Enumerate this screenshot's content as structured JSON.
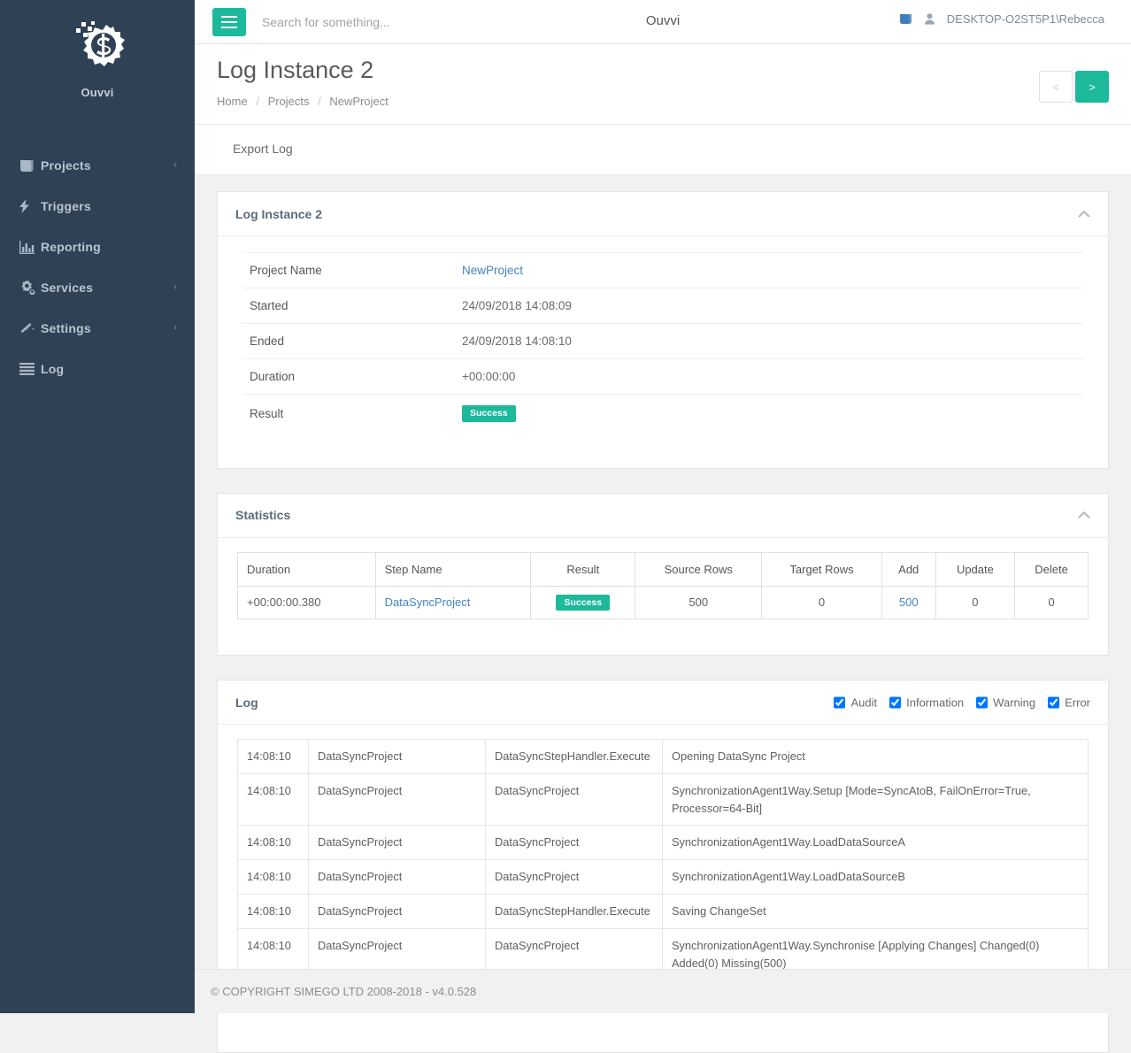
{
  "brand": {
    "name": "Ouvvi",
    "logo_icon": "gear-s-logo-icon"
  },
  "sidebar": {
    "items": [
      {
        "label": "Projects",
        "icon": "book-icon",
        "caret": "‹"
      },
      {
        "label": "Triggers",
        "icon": "bolt-icon",
        "caret": ""
      },
      {
        "label": "Reporting",
        "icon": "bar-chart-icon",
        "caret": ""
      },
      {
        "label": "Services",
        "icon": "cogs-icon",
        "caret": "‹"
      },
      {
        "label": "Settings",
        "icon": "magic-wand-icon",
        "caret": "‹"
      },
      {
        "label": "Log",
        "icon": "list-icon",
        "caret": ""
      }
    ]
  },
  "topbar": {
    "menu_icon": "hamburger-icon",
    "search_placeholder": "Search for something...",
    "search_value": "",
    "title": "Ouvvi",
    "book_icon": "book-icon",
    "user_icon": "user-icon",
    "username": "DESKTOP-O2ST5P1\\Rebecca"
  },
  "page": {
    "title": "Log Instance 2",
    "breadcrumb": [
      {
        "label": "Home"
      },
      {
        "label": "Projects"
      },
      {
        "label": "NewProject"
      }
    ],
    "breadcrumb_separator": "/",
    "pager": {
      "prev_label": "<",
      "next_label": ">"
    },
    "action_bar": {
      "export_log_label": "Export Log"
    }
  },
  "cards": {
    "instance": {
      "title": "Log Instance 2",
      "collapse_icon": "chevron-up-icon",
      "rows": [
        {
          "label": "Project Name",
          "value": "NewProject",
          "type": "link"
        },
        {
          "label": "Started",
          "value": "24/09/2018 14:08:09",
          "type": "text"
        },
        {
          "label": "Ended",
          "value": "24/09/2018 14:08:10",
          "type": "text"
        },
        {
          "label": "Duration",
          "value": "+00:00:00",
          "type": "text"
        },
        {
          "label": "Result",
          "value": "Success",
          "type": "badge"
        }
      ]
    },
    "statistics": {
      "title": "Statistics",
      "collapse_icon": "chevron-up-icon",
      "columns": [
        "Duration",
        "Step Name",
        "Result",
        "Source Rows",
        "Target Rows",
        "Add",
        "Update",
        "Delete"
      ],
      "rows": [
        {
          "duration": "+00:00:00.380",
          "step_name": "DataSyncProject",
          "result": "Success",
          "source_rows": "500",
          "target_rows": "0",
          "add": "500",
          "update": "0",
          "delete": "0"
        }
      ]
    },
    "log": {
      "title": "Log",
      "filters": [
        {
          "label": "Audit",
          "checked": true
        },
        {
          "label": "Information",
          "checked": true
        },
        {
          "label": "Warning",
          "checked": true
        },
        {
          "label": "Error",
          "checked": true
        }
      ],
      "rows": [
        {
          "time": "14:08:10",
          "project": "DataSyncProject",
          "source": "DataSyncStepHandler.Execute",
          "message": "Opening DataSync Project"
        },
        {
          "time": "14:08:10",
          "project": "DataSyncProject",
          "source": "DataSyncProject",
          "message": "SynchronizationAgent1Way.Setup [Mode=SyncAtoB, FailOnError=True, Processor=64-Bit]"
        },
        {
          "time": "14:08:10",
          "project": "DataSyncProject",
          "source": "DataSyncProject",
          "message": "SynchronizationAgent1Way.LoadDataSourceA"
        },
        {
          "time": "14:08:10",
          "project": "DataSyncProject",
          "source": "DataSyncProject",
          "message": "SynchronizationAgent1Way.LoadDataSourceB"
        },
        {
          "time": "14:08:10",
          "project": "DataSyncProject",
          "source": "DataSyncStepHandler.Execute",
          "message": "Saving ChangeSet"
        },
        {
          "time": "14:08:10",
          "project": "DataSyncProject",
          "source": "DataSyncProject",
          "message": "SynchronizationAgent1Way.Synchronise [Applying Changes] Changed(0) Added(0) Missing(500)"
        }
      ]
    }
  },
  "footer": {
    "text": "© COPYRIGHT SIMEGO LTD 2008-2018 - v4.0.528"
  },
  "colors": {
    "accent_green": "#1cb99a",
    "sidebar_bg": "#2f4154",
    "link_blue": "#4484c4",
    "page_bg": "#f1f1f1"
  }
}
